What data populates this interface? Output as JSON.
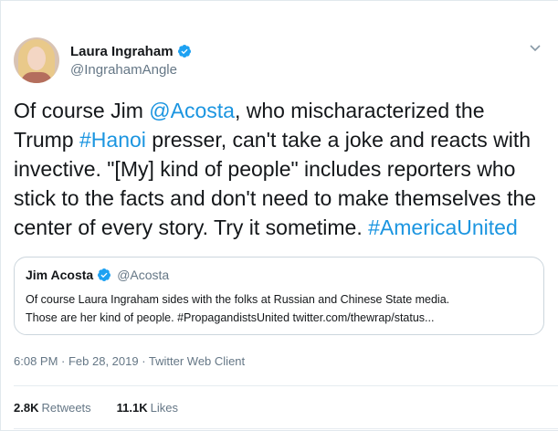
{
  "author": {
    "display_name": "Laura Ingraham",
    "handle": "@IngrahamAngle"
  },
  "tweet": {
    "lines": [
      {
        "parts": [
          "Of course Jim ",
          "@Acosta",
          ", who mischaracterized the"
        ]
      },
      {
        "parts": [
          "Trump ",
          "#Hanoi",
          " presser, can't take a joke and reacts with"
        ]
      },
      {
        "parts": [
          "invective. \"[My] kind of people\" includes reporters who"
        ]
      },
      {
        "parts": [
          "stick to the facts and don't need to make themselves the"
        ]
      },
      {
        "parts": [
          "center of every story. Try it sometime. ",
          "#AmericaUnited"
        ]
      }
    ]
  },
  "quoted": {
    "display_name": "Jim Acosta",
    "handle": "@Acosta",
    "line1": "Of course Laura Ingraham sides with the folks at Russian and Chinese State media.",
    "line2": "Those are her kind of people. #PropagandistsUnited twitter.com/thewrap/status..."
  },
  "meta": {
    "timestamp": "6:08 PM · Feb 28, 2019 · Twitter Web Client"
  },
  "stats": {
    "retweets_count": "2.8K",
    "retweets_label": "Retweets",
    "likes_count": "11.1K",
    "likes_label": "Likes"
  },
  "colors": {
    "link": "#1b95e0",
    "text": "#14171a",
    "muted": "#657786",
    "verified": "#1da1f2"
  },
  "icons": [
    "verified-badge-icon",
    "chevron-down-icon"
  ]
}
